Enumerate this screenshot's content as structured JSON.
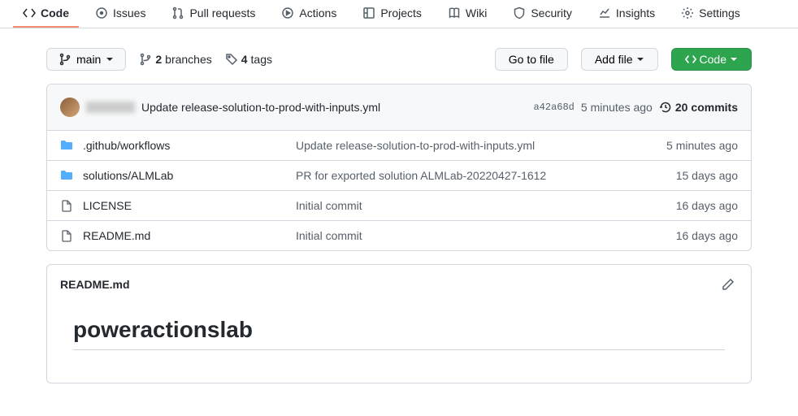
{
  "tabs": [
    {
      "label": "Code"
    },
    {
      "label": "Issues"
    },
    {
      "label": "Pull requests"
    },
    {
      "label": "Actions"
    },
    {
      "label": "Projects"
    },
    {
      "label": "Wiki"
    },
    {
      "label": "Security"
    },
    {
      "label": "Insights"
    },
    {
      "label": "Settings"
    }
  ],
  "branch": {
    "name": "main"
  },
  "counts": {
    "branches_n": "2",
    "branches_label": "branches",
    "tags_n": "4",
    "tags_label": "tags"
  },
  "actions": {
    "go_to_file": "Go to file",
    "add_file": "Add file",
    "code": "Code"
  },
  "latest_commit": {
    "message": "Update release-solution-to-prod-with-inputs.yml",
    "sha": "a42a68d",
    "time": "5 minutes ago",
    "commits_n": "20",
    "commits_label": "commits"
  },
  "files": [
    {
      "name": ".github/workflows",
      "msg": "Update release-solution-to-prod-with-inputs.yml",
      "time": "5 minutes ago",
      "type": "dir"
    },
    {
      "name": "solutions/ALMLab",
      "msg": "PR for exported solution ALMLab-20220427-1612",
      "time": "15 days ago",
      "type": "dir"
    },
    {
      "name": "LICENSE",
      "msg": "Initial commit",
      "time": "16 days ago",
      "type": "file"
    },
    {
      "name": "README.md",
      "msg": "Initial commit",
      "time": "16 days ago",
      "type": "file"
    }
  ],
  "readme": {
    "filename": "README.md",
    "heading": "poweractionslab"
  }
}
